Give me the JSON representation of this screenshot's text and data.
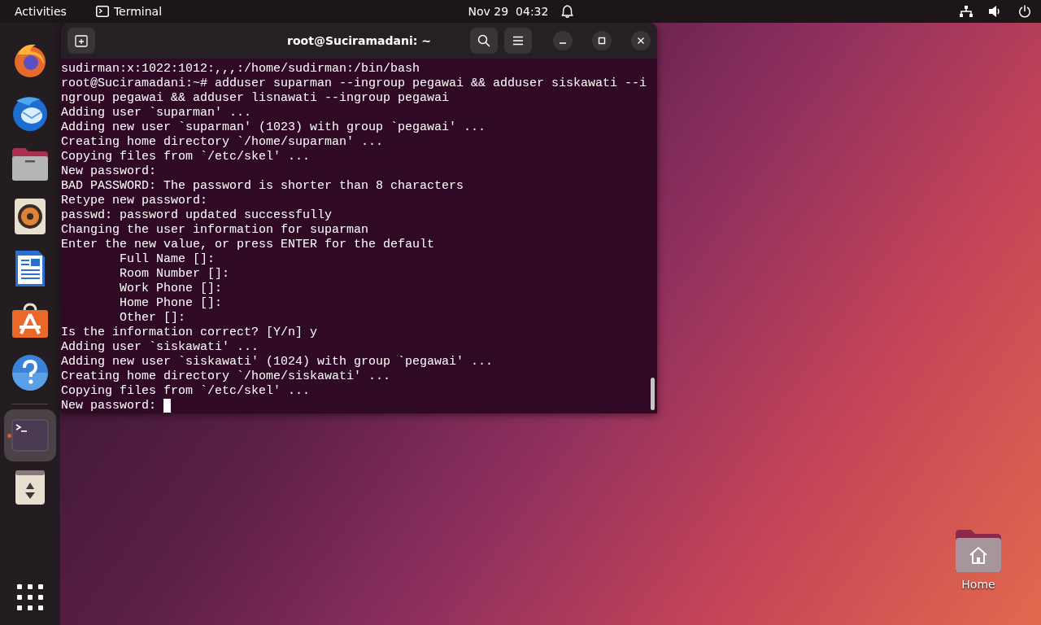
{
  "top_bar": {
    "activities": "Activities",
    "app_menu": "Terminal",
    "clock": "Nov 29  04:32"
  },
  "dock": [
    {
      "kind": "browser",
      "running": false,
      "selected": false
    },
    {
      "kind": "mail",
      "running": false,
      "selected": false
    },
    {
      "kind": "files",
      "running": false,
      "selected": false
    },
    {
      "kind": "music",
      "running": false,
      "selected": false
    },
    {
      "kind": "writer",
      "running": false,
      "selected": false
    },
    {
      "kind": "software",
      "running": false,
      "selected": false
    },
    {
      "kind": "help",
      "running": false,
      "selected": false
    },
    {
      "kind": "terminal",
      "running": true,
      "selected": true
    },
    {
      "kind": "trash",
      "running": false,
      "selected": false
    }
  ],
  "window": {
    "title": "root@Suciramadani: ~",
    "lines": [
      "sudirman:x:1022:1012:,,,:/home/sudirman:/bin/bash",
      "root@Suciramadani:~# adduser suparman --ingroup pegawai && adduser siskawati --i",
      "ngroup pegawai && adduser lisnawati --ingroup pegawai",
      "Adding user `suparman' ...",
      "Adding new user `suparman' (1023) with group `pegawai' ...",
      "Creating home directory `/home/suparman' ...",
      "Copying files from `/etc/skel' ...",
      "New password:",
      "BAD PASSWORD: The password is shorter than 8 characters",
      "Retype new password:",
      "passwd: password updated successfully",
      "Changing the user information for suparman",
      "Enter the new value, or press ENTER for the default",
      "        Full Name []:",
      "        Room Number []:",
      "        Work Phone []:",
      "        Home Phone []:",
      "        Other []:",
      "Is the information correct? [Y/n] y",
      "Adding user `siskawati' ...",
      "Adding new user `siskawati' (1024) with group `pegawai' ...",
      "Creating home directory `/home/siskawati' ...",
      "Copying files from `/etc/skel' ...",
      "New password: "
    ]
  },
  "desktop_icons": [
    {
      "label": "Home"
    }
  ]
}
